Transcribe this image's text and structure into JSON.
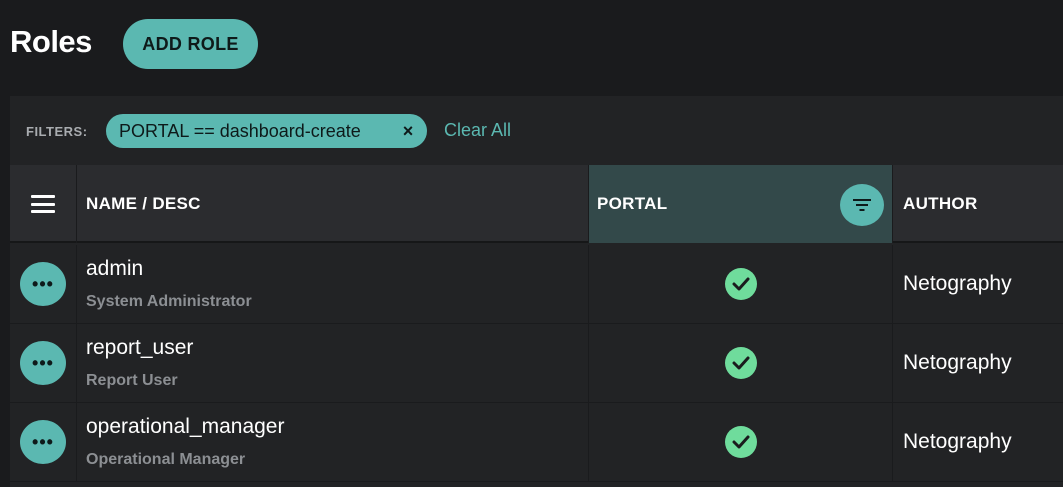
{
  "header": {
    "title": "Roles",
    "add_button_label": "ADD ROLE"
  },
  "filters": {
    "label": "FILTERS:",
    "chips": [
      {
        "text": "PORTAL == dashboard-create",
        "close_glyph": "×"
      }
    ],
    "clear_all_label": "Clear All"
  },
  "table": {
    "columns": {
      "name": "NAME / DESC",
      "portal": "PORTAL",
      "author": "AUTHOR"
    },
    "rows": [
      {
        "name": "admin",
        "desc": "System Administrator",
        "portal": true,
        "author": "Netography"
      },
      {
        "name": "report_user",
        "desc": "Report User",
        "portal": true,
        "author": "Netography"
      },
      {
        "name": "operational_manager",
        "desc": "Operational Manager",
        "portal": true,
        "author": "Netography"
      }
    ],
    "more_glyph": "•••"
  },
  "icons": {
    "column_menu": "hamburger-menu-icon",
    "portal_filter": "filter-icon",
    "row_actions": "more-horizontal-icon",
    "portal_enabled": "check-circle-icon"
  },
  "colors": {
    "accent": "#5bb8b1",
    "check": "#6fdc9c",
    "background": "#1a1b1d",
    "panel": "#222325",
    "active_column": "#33494a"
  }
}
